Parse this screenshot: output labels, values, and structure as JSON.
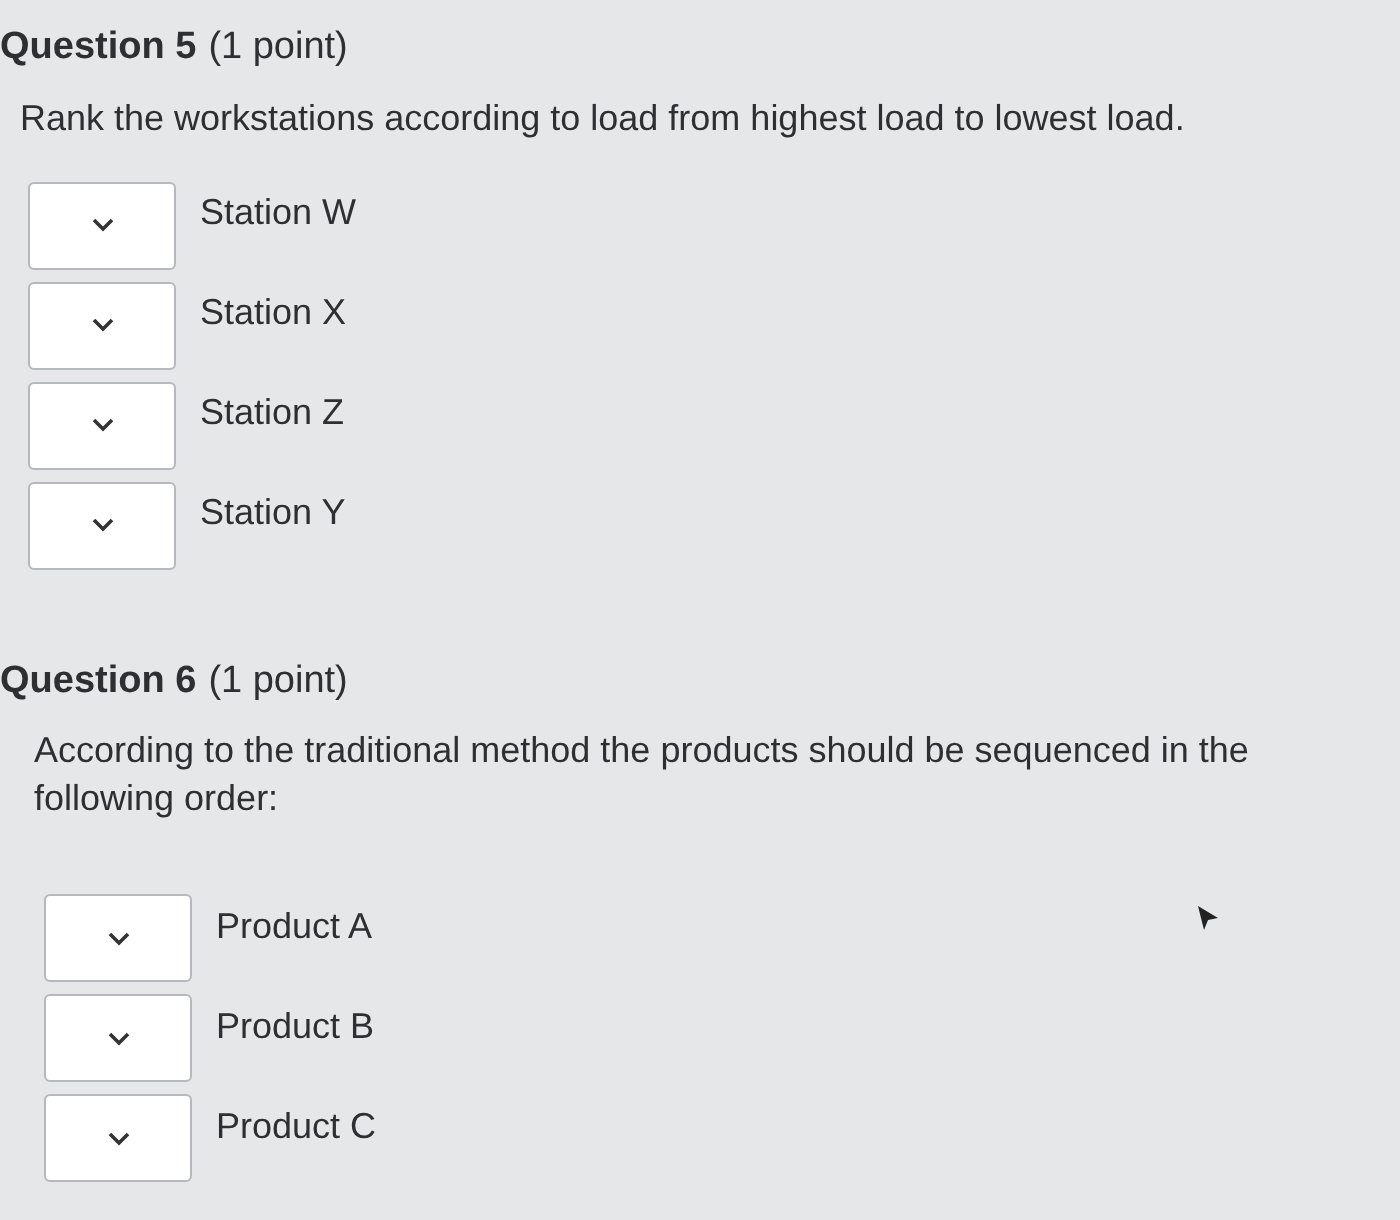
{
  "questions": [
    {
      "number": "Question 5",
      "points": "(1 point)",
      "prompt": "Rank the workstations according to load from highest load to lowest load.",
      "items": [
        {
          "label": "Station W"
        },
        {
          "label": "Station X"
        },
        {
          "label": "Station Z"
        },
        {
          "label": "Station Y"
        }
      ]
    },
    {
      "number": "Question 6",
      "points": "(1 point)",
      "prompt": "According to the traditional method the products should be sequenced in the following order:",
      "items": [
        {
          "label": "Product A"
        },
        {
          "label": "Product B"
        },
        {
          "label": "Product C"
        }
      ]
    }
  ]
}
